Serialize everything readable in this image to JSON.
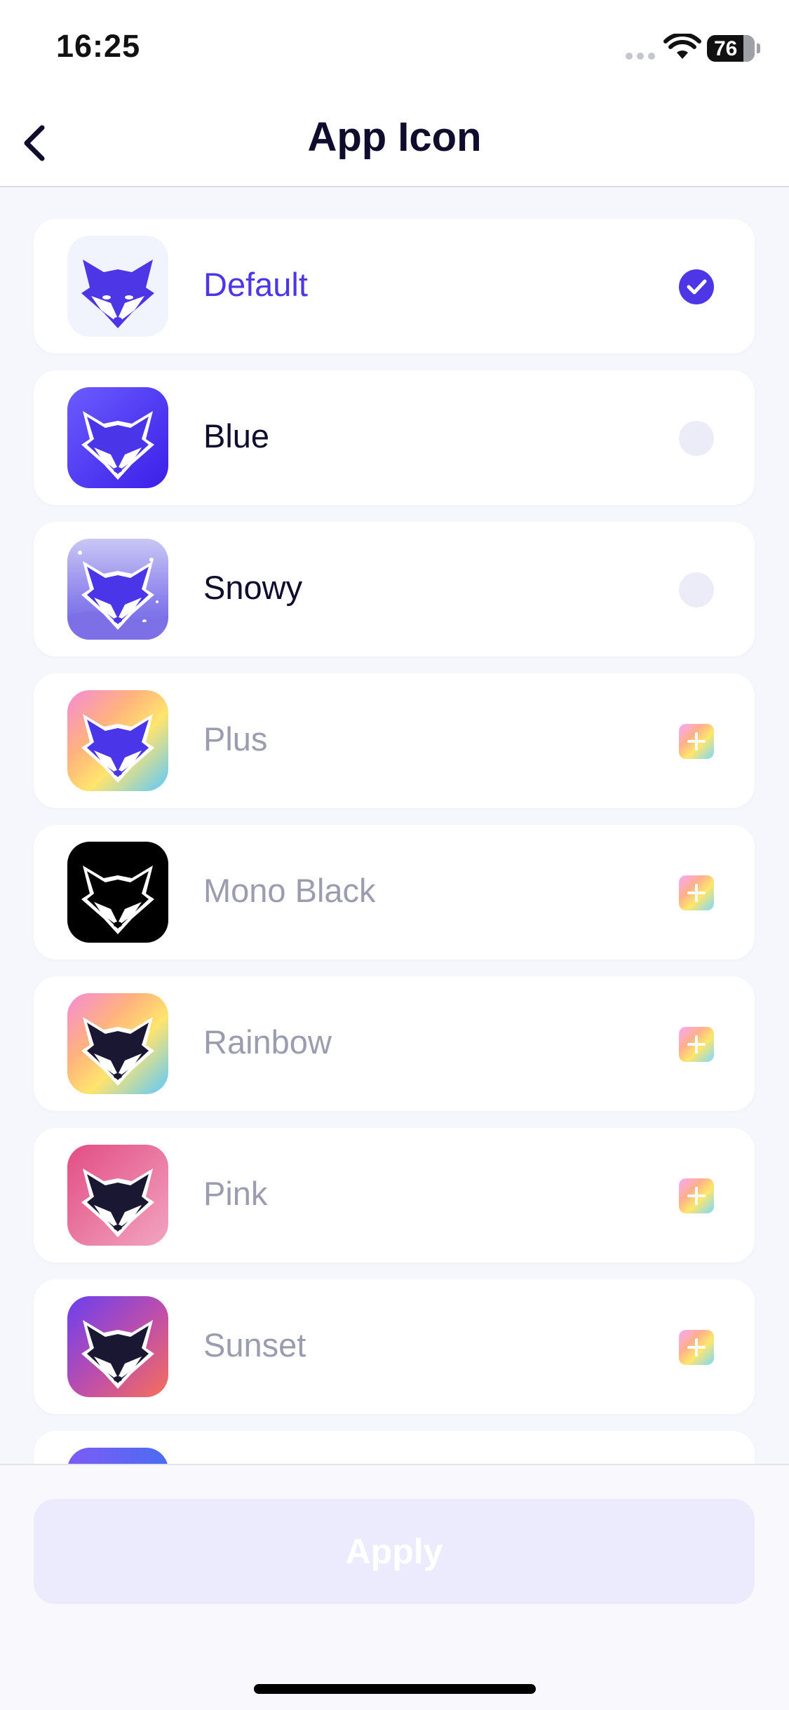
{
  "status_bar": {
    "time": "16:25",
    "battery": "76"
  },
  "nav": {
    "title": "App Icon",
    "back_icon": "chevron-left-icon"
  },
  "icons": [
    {
      "label": "Default",
      "state": "selected",
      "label_color": "#4d36e6"
    },
    {
      "label": "Blue",
      "state": "unselected",
      "label_color": "#0f0c2e"
    },
    {
      "label": "Snowy",
      "state": "unselected",
      "label_color": "#0f0c2e"
    },
    {
      "label": "Plus",
      "state": "locked",
      "label_color": "#9c9cb0"
    },
    {
      "label": "Mono Black",
      "state": "locked",
      "label_color": "#9c9cb0"
    },
    {
      "label": "Rainbow",
      "state": "locked",
      "label_color": "#9c9cb0"
    },
    {
      "label": "Pink",
      "state": "locked",
      "label_color": "#9c9cb0"
    },
    {
      "label": "Sunset",
      "state": "locked",
      "label_color": "#9c9cb0"
    },
    {
      "label": "",
      "state": "",
      "label_color": "#9c9cb0"
    }
  ],
  "apply": {
    "label": "Apply"
  },
  "colors": {
    "accent": "#4d36e6",
    "background": "#f6f7fd",
    "apply_disabled": "#ecebfd"
  }
}
